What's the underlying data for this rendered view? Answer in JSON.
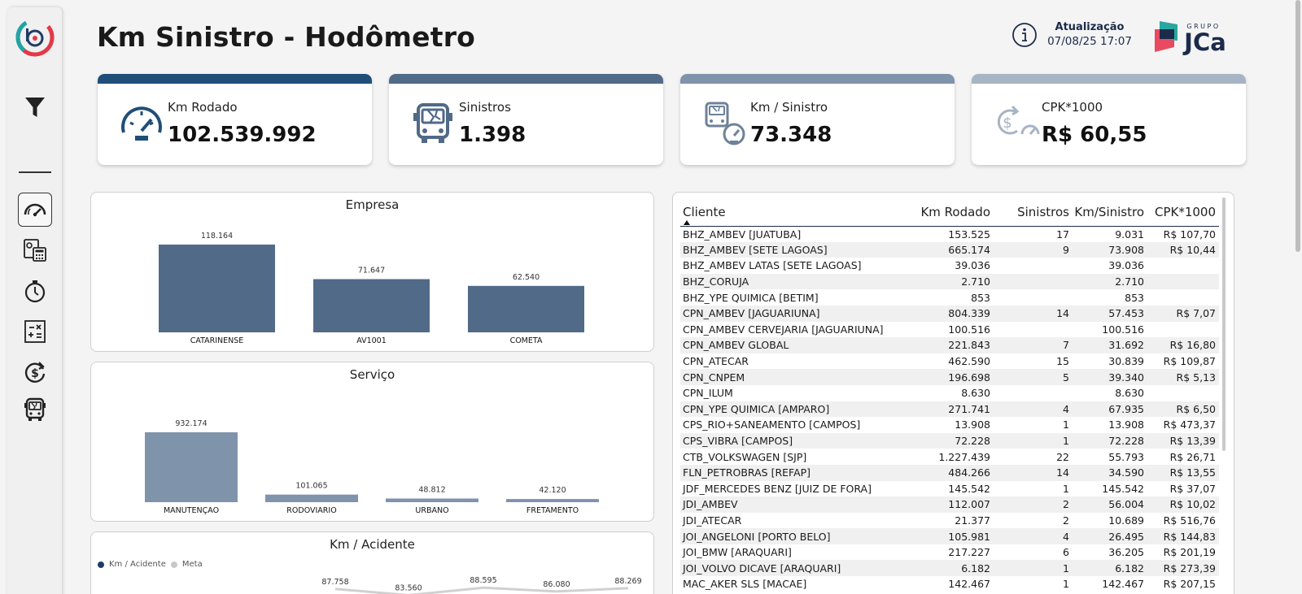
{
  "header": {
    "title": "Km Sinistro - Hodômetro",
    "update_label": "Atualização",
    "update_value": "07/08/25 17:07",
    "brand_top": "GRUPO",
    "brand_name": "JCa"
  },
  "colors": {
    "navy": "#1f4e79",
    "steel": "#506a88",
    "slate": "#7f93ab",
    "light": "#a6b4c4",
    "accent_blue": "#1f3b66"
  },
  "sidebar": {
    "items": [
      {
        "name": "dashboard-speedometer",
        "icon": "speedometer-icon",
        "active": true
      },
      {
        "name": "report-calculator",
        "icon": "calculator-icon",
        "active": false
      },
      {
        "name": "timer",
        "icon": "stopwatch-icon",
        "active": false
      },
      {
        "name": "math-sheet",
        "icon": "math-icon",
        "active": false
      },
      {
        "name": "cost",
        "icon": "dollar-refresh-icon",
        "active": false
      },
      {
        "name": "bus-crash",
        "icon": "bus-icon",
        "active": false
      }
    ]
  },
  "kpis": [
    {
      "label": "Km Rodado",
      "value": "102.539.992",
      "icon": "speedometer-icon"
    },
    {
      "label": "Sinistros",
      "value": "1.398",
      "icon": "bus-crash-icon"
    },
    {
      "label": "Km / Sinistro",
      "value": "73.348",
      "icon": "bus-gauge-icon"
    },
    {
      "label": "CPK*1000",
      "value": "R$ 60,55",
      "icon": "dollar-gauge-icon"
    }
  ],
  "chart_data": [
    {
      "type": "bar",
      "title": "Empresa",
      "categories": [
        "CATARINENSE",
        "AV1001",
        "COMETA"
      ],
      "values": [
        118164,
        71647,
        62540
      ],
      "labels": [
        "118.164",
        "71.647",
        "62.540"
      ],
      "color": "#506a88"
    },
    {
      "type": "bar",
      "title": "Serviço",
      "categories": [
        "MANUTENÇAO",
        "RODOVIARIO",
        "URBANO",
        "FRETAMENTO"
      ],
      "values": [
        932174,
        101065,
        48812,
        42120
      ],
      "labels": [
        "932.174",
        "101.065",
        "48.812",
        "42.120"
      ],
      "color": "#7f93ab"
    },
    {
      "type": "line",
      "title": "Km / Acidente",
      "series": [
        {
          "name": "Km / Acidente",
          "values": [
            87758,
            83560,
            88595,
            86080,
            88269
          ],
          "labels": [
            "87.758",
            "83.560",
            "88.595",
            "86.080",
            "88.269"
          ],
          "color": "#1f3b66"
        },
        {
          "name": "Meta",
          "color": "#c8c8c8"
        }
      ]
    }
  ],
  "table": {
    "columns": [
      "Cliente",
      "Km Rodado",
      "Sinistros",
      "Km/Sinistro",
      "CPK*1000"
    ],
    "rows": [
      [
        "BHZ_AMBEV [JUATUBA]",
        "153.525",
        "17",
        "9.031",
        "R$ 107,70"
      ],
      [
        "BHZ_AMBEV [SETE LAGOAS]",
        "665.174",
        "9",
        "73.908",
        "R$ 10,44"
      ],
      [
        "BHZ_AMBEV LATAS [SETE LAGOAS]",
        "39.036",
        "",
        "39.036",
        ""
      ],
      [
        "BHZ_CORUJA",
        "2.710",
        "",
        "2.710",
        ""
      ],
      [
        "BHZ_YPE QUIMICA [BETIM]",
        "853",
        "",
        "853",
        ""
      ],
      [
        "CPN_AMBEV [JAGUARIUNA]",
        "804.339",
        "14",
        "57.453",
        "R$ 7,07"
      ],
      [
        "CPN_AMBEV CERVEJARIA [JAGUARIUNA]",
        "100.516",
        "",
        "100.516",
        ""
      ],
      [
        "CPN_AMBEV GLOBAL",
        "221.843",
        "7",
        "31.692",
        "R$ 16,80"
      ],
      [
        "CPN_ATECAR",
        "462.590",
        "15",
        "30.839",
        "R$ 109,87"
      ],
      [
        "CPN_CNPEM",
        "196.698",
        "5",
        "39.340",
        "R$ 5,13"
      ],
      [
        "CPN_ILUM",
        "8.630",
        "",
        "8.630",
        ""
      ],
      [
        "CPN_YPE QUIMICA [AMPARO]",
        "271.741",
        "4",
        "67.935",
        "R$ 6,50"
      ],
      [
        "CPS_RIO+SANEAMENTO [CAMPOS]",
        "13.908",
        "1",
        "13.908",
        "R$ 473,37"
      ],
      [
        "CPS_VIBRA [CAMPOS]",
        "72.228",
        "1",
        "72.228",
        "R$ 13,39"
      ],
      [
        "CTB_VOLKSWAGEN [SJP]",
        "1.227.439",
        "22",
        "55.793",
        "R$ 26,71"
      ],
      [
        "FLN_PETROBRAS [REFAP]",
        "484.266",
        "14",
        "34.590",
        "R$ 13,55"
      ],
      [
        "JDF_MERCEDES BENZ [JUIZ DE FORA]",
        "145.542",
        "1",
        "145.542",
        "R$ 37,07"
      ],
      [
        "JDI_AMBEV",
        "112.007",
        "2",
        "56.004",
        "R$ 10,02"
      ],
      [
        "JDI_ATECAR",
        "21.377",
        "2",
        "10.689",
        "R$ 516,76"
      ],
      [
        "JOI_ANGELONI [PORTO BELO]",
        "105.981",
        "4",
        "26.495",
        "R$ 144,83"
      ],
      [
        "JOI_BMW [ARAQUARI]",
        "217.227",
        "6",
        "36.205",
        "R$ 201,19"
      ],
      [
        "JOI_VOLVO DICAVE [ARAQUARI]",
        "6.182",
        "1",
        "6.182",
        "R$ 273,39"
      ],
      [
        "MAC_AKER SLS [MACAE]",
        "142.467",
        "1",
        "142.467",
        "R$ 207,15"
      ]
    ]
  }
}
